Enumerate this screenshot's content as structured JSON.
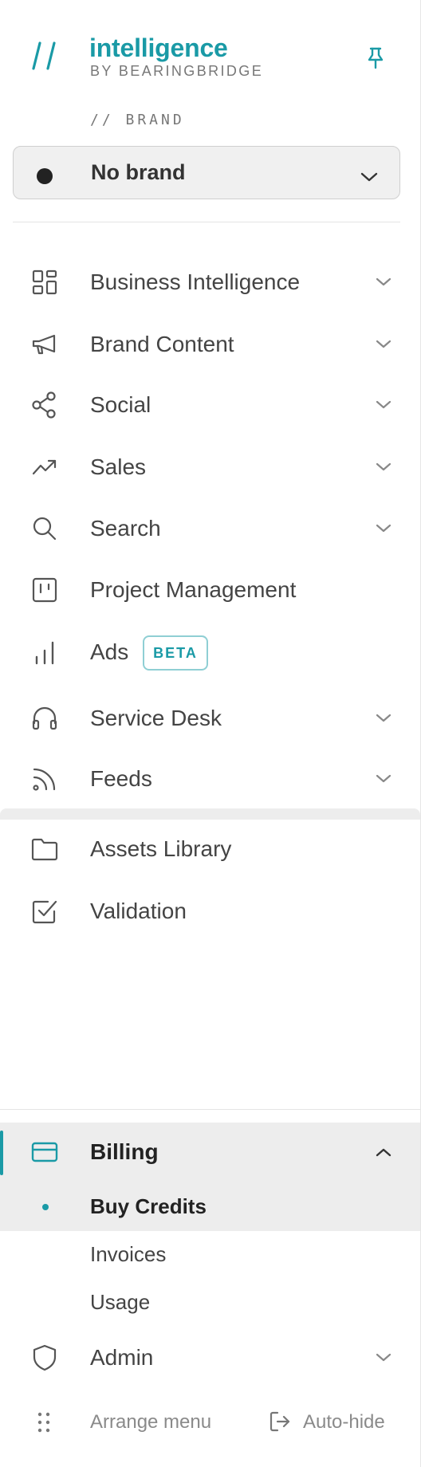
{
  "header": {
    "logo_mark": "//",
    "title": "intelligence",
    "subtitle": "BY BEARINGBRIDGE",
    "pin_icon": "pin-icon"
  },
  "brand": {
    "section_label": "// BRAND",
    "selected": "No brand"
  },
  "nav": {
    "items": [
      {
        "label": "Business Intelligence",
        "icon": "grid-icon",
        "expandable": true
      },
      {
        "label": "Brand Content",
        "icon": "megaphone-icon",
        "expandable": true
      },
      {
        "label": "Social",
        "icon": "share-icon",
        "expandable": true
      },
      {
        "label": "Sales",
        "icon": "trend-up-icon",
        "expandable": true
      },
      {
        "label": "Search",
        "icon": "search-icon",
        "expandable": true
      },
      {
        "label": "Project Management",
        "icon": "board-icon",
        "expandable": false
      },
      {
        "label": "Ads",
        "icon": "bar-chart-icon",
        "expandable": false,
        "badge": "BETA"
      },
      {
        "label": "Service Desk",
        "icon": "headphones-icon",
        "expandable": true
      },
      {
        "label": "Feeds",
        "icon": "rss-icon",
        "expandable": true
      },
      {
        "label": "Assets Library",
        "icon": "folder-icon",
        "expandable": false
      },
      {
        "label": "Validation",
        "icon": "checkbox-icon",
        "expandable": false
      }
    ]
  },
  "billing": {
    "label": "Billing",
    "icon": "credit-card-icon",
    "expanded": true,
    "children": [
      {
        "label": "Buy Credits",
        "active": true
      },
      {
        "label": "Invoices",
        "active": false
      },
      {
        "label": "Usage",
        "active": false
      }
    ]
  },
  "admin": {
    "label": "Admin",
    "icon": "shield-icon"
  },
  "footer": {
    "arrange_label": "Arrange menu",
    "autohide_label": "Auto-hide"
  },
  "colors": {
    "accent": "#1a9aa6",
    "text": "#444444",
    "muted": "#8a8a8a",
    "active_bg": "#ededed"
  }
}
